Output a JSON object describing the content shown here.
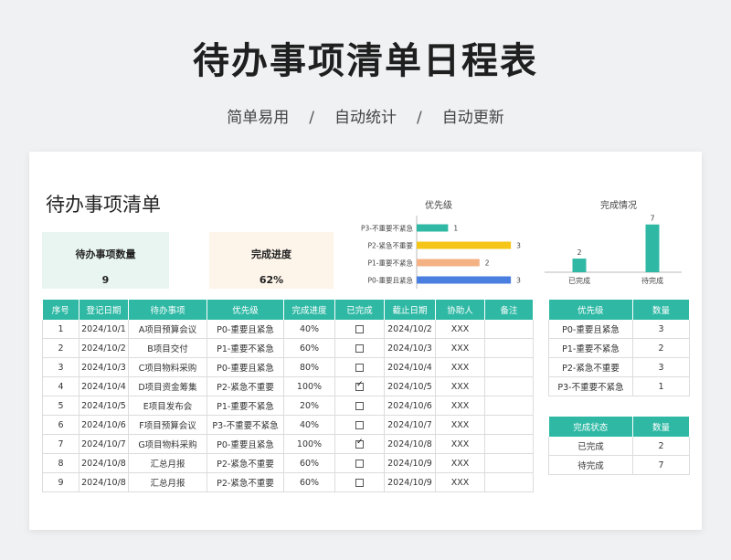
{
  "header": {
    "title": "待办事项清单日程表",
    "taglines": [
      "简单易用",
      "自动统计",
      "自动更新"
    ],
    "separator": "/"
  },
  "sheet": {
    "title": "待办事项清单",
    "count_card": {
      "label": "待办事项数量",
      "value": "9"
    },
    "progress_card": {
      "label": "完成进度",
      "value": "62%"
    }
  },
  "chart_data": [
    {
      "type": "bar",
      "orientation": "horizontal",
      "title": "优先级",
      "categories": [
        "P3-不重要不紧急",
        "P2-紧急不重要",
        "P1-重要不紧急",
        "P0-重要且紧急"
      ],
      "values": [
        1,
        3,
        2,
        3
      ],
      "colors": [
        "#2fb9a5",
        "#f5c518",
        "#f4b183",
        "#4a7fe0"
      ],
      "xlim": [
        0,
        3.2
      ]
    },
    {
      "type": "bar",
      "title": "完成情况",
      "categories": [
        "已完成",
        "待完成"
      ],
      "values": [
        2,
        7
      ],
      "colors": [
        "#2fb9a5",
        "#2fb9a5"
      ],
      "ylim": [
        0,
        7.5
      ]
    }
  ],
  "main_table": {
    "headers": [
      "序号",
      "登记日期",
      "待办事项",
      "优先级",
      "完成进度",
      "已完成",
      "截止日期",
      "协助人",
      "备注"
    ],
    "rows": [
      [
        "1",
        "2024/10/1",
        "A项目预算会议",
        "P0-重要且紧急",
        "40%",
        false,
        "2024/10/2",
        "XXX",
        ""
      ],
      [
        "2",
        "2024/10/2",
        "B项目交付",
        "P1-重要不紧急",
        "60%",
        false,
        "2024/10/3",
        "XXX",
        ""
      ],
      [
        "3",
        "2024/10/3",
        "C项目物料采购",
        "P0-重要且紧急",
        "80%",
        false,
        "2024/10/4",
        "XXX",
        ""
      ],
      [
        "4",
        "2024/10/4",
        "D项目资金筹集",
        "P2-紧急不重要",
        "100%",
        true,
        "2024/10/5",
        "XXX",
        ""
      ],
      [
        "5",
        "2024/10/5",
        "E项目发布会",
        "P1-重要不紧急",
        "20%",
        false,
        "2024/10/6",
        "XXX",
        ""
      ],
      [
        "6",
        "2024/10/6",
        "F项目预算会议",
        "P3-不重要不紧急",
        "40%",
        false,
        "2024/10/7",
        "XXX",
        ""
      ],
      [
        "7",
        "2024/10/7",
        "G项目物料采购",
        "P0-重要且紧急",
        "100%",
        true,
        "2024/10/8",
        "XXX",
        ""
      ],
      [
        "8",
        "2024/10/8",
        "汇总月报",
        "P2-紧急不重要",
        "60%",
        false,
        "2024/10/9",
        "XXX",
        ""
      ],
      [
        "9",
        "2024/10/8",
        "汇总月报",
        "P2-紧急不重要",
        "60%",
        false,
        "2024/10/9",
        "XXX",
        ""
      ]
    ]
  },
  "priority_table": {
    "headers": [
      "优先级",
      "数量"
    ],
    "rows": [
      [
        "P0-重要且紧急",
        "3"
      ],
      [
        "P1-重要不紧急",
        "2"
      ],
      [
        "P2-紧急不重要",
        "3"
      ],
      [
        "P3-不重要不紧急",
        "1"
      ]
    ]
  },
  "status_table": {
    "headers": [
      "完成状态",
      "数量"
    ],
    "rows": [
      [
        "已完成",
        "2"
      ],
      [
        "待完成",
        "7"
      ]
    ]
  }
}
